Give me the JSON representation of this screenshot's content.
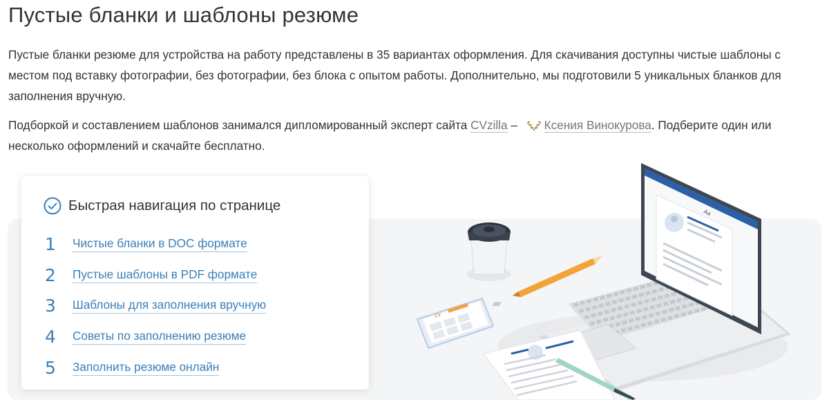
{
  "page": {
    "title": "Пустые бланки и шаблоны резюме",
    "intro": "Пустые бланки резюме для устройства на работу представлены в 35 вариантах оформления. Для скачивания доступны чистые шаблоны с местом под вставку фотографии, без фотографии, без блока с опытом работы. Дополнительно, мы подготовили 5 уникальных бланков для заполнения вручную.",
    "credit_prefix": "Подборкой и составлением шаблонов занимался дипломированный эксперт сайта ",
    "site_link": "CVzilla",
    "dash": " – ",
    "expert_link": "Ксения Винокурова",
    "credit_suffix": ". Подберите один или несколько оформлений и скачайте бесплатно."
  },
  "nav": {
    "title": "Быстрая навигация по странице",
    "items": [
      {
        "num": "1",
        "label": "Чистые бланки в DOC формате"
      },
      {
        "num": "2",
        "label": "Пустые шаблоны в PDF формате"
      },
      {
        "num": "3",
        "label": "Шаблоны для заполнения вручную"
      },
      {
        "num": "4",
        "label": "Советы по заполнению резюме"
      },
      {
        "num": "5",
        "label": "Заполнить резюме онлайн"
      }
    ]
  },
  "illustration": {
    "laptop_font_sample": "Aa",
    "phone_logo": "CV"
  },
  "colors": {
    "accent": "#3a7fb8",
    "text": "#333333",
    "muted_link": "#777777",
    "bg_panel": "#f4f5f6",
    "laurel": "#b58a4c"
  },
  "icons": {
    "nav_check": "check-circle-icon",
    "expert_badge": "laurel-icon"
  }
}
